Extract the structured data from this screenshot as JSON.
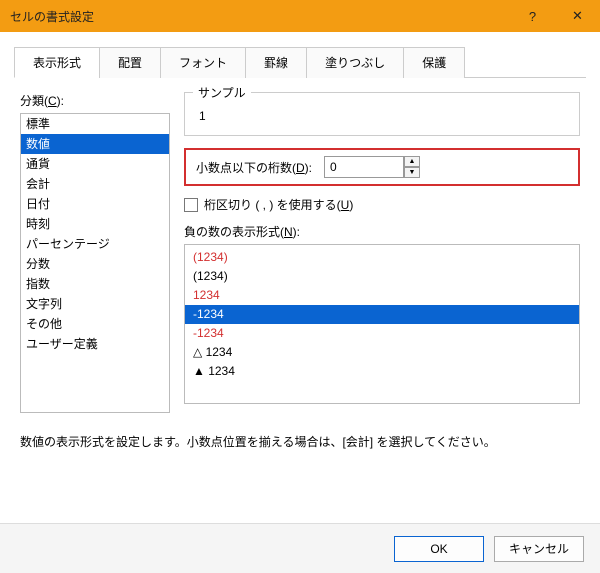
{
  "title": "セルの書式設定",
  "titlebar": {
    "help": "?",
    "close": "✕"
  },
  "tabs": [
    "表示形式",
    "配置",
    "フォント",
    "罫線",
    "塗りつぶし",
    "保護"
  ],
  "active_tab": 0,
  "category_label_pre": "分類(",
  "category_label_key": "C",
  "category_label_post": "):",
  "categories": [
    "標準",
    "数値",
    "通貨",
    "会計",
    "日付",
    "時刻",
    "パーセンテージ",
    "分数",
    "指数",
    "文字列",
    "その他",
    "ユーザー定義"
  ],
  "category_selected": 1,
  "sample": {
    "legend": "サンプル",
    "value": "1"
  },
  "decimal": {
    "label_pre": "小数点以下の桁数(",
    "label_key": "D",
    "label_post": "):",
    "value": "0"
  },
  "thousands": {
    "label_pre": "桁区切り ( , ) を使用する(",
    "label_key": "U",
    "label_post": ")"
  },
  "negative_label_pre": "負の数の表示形式(",
  "negative_label_key": "N",
  "negative_label_post": "):",
  "negatives": [
    {
      "text": "(1234)",
      "cls": "red-text"
    },
    {
      "text": "(1234)",
      "cls": ""
    },
    {
      "text": "1234",
      "cls": "red-text"
    },
    {
      "text": "-1234",
      "cls": "sel"
    },
    {
      "text": "-1234",
      "cls": "red-text"
    },
    {
      "text": "△ 1234",
      "cls": ""
    },
    {
      "text": "▲ 1234",
      "cls": ""
    }
  ],
  "description": "数値の表示形式を設定します。小数点位置を揃える場合は、[会計] を選択してください。",
  "buttons": {
    "ok": "OK",
    "cancel": "キャンセル"
  }
}
